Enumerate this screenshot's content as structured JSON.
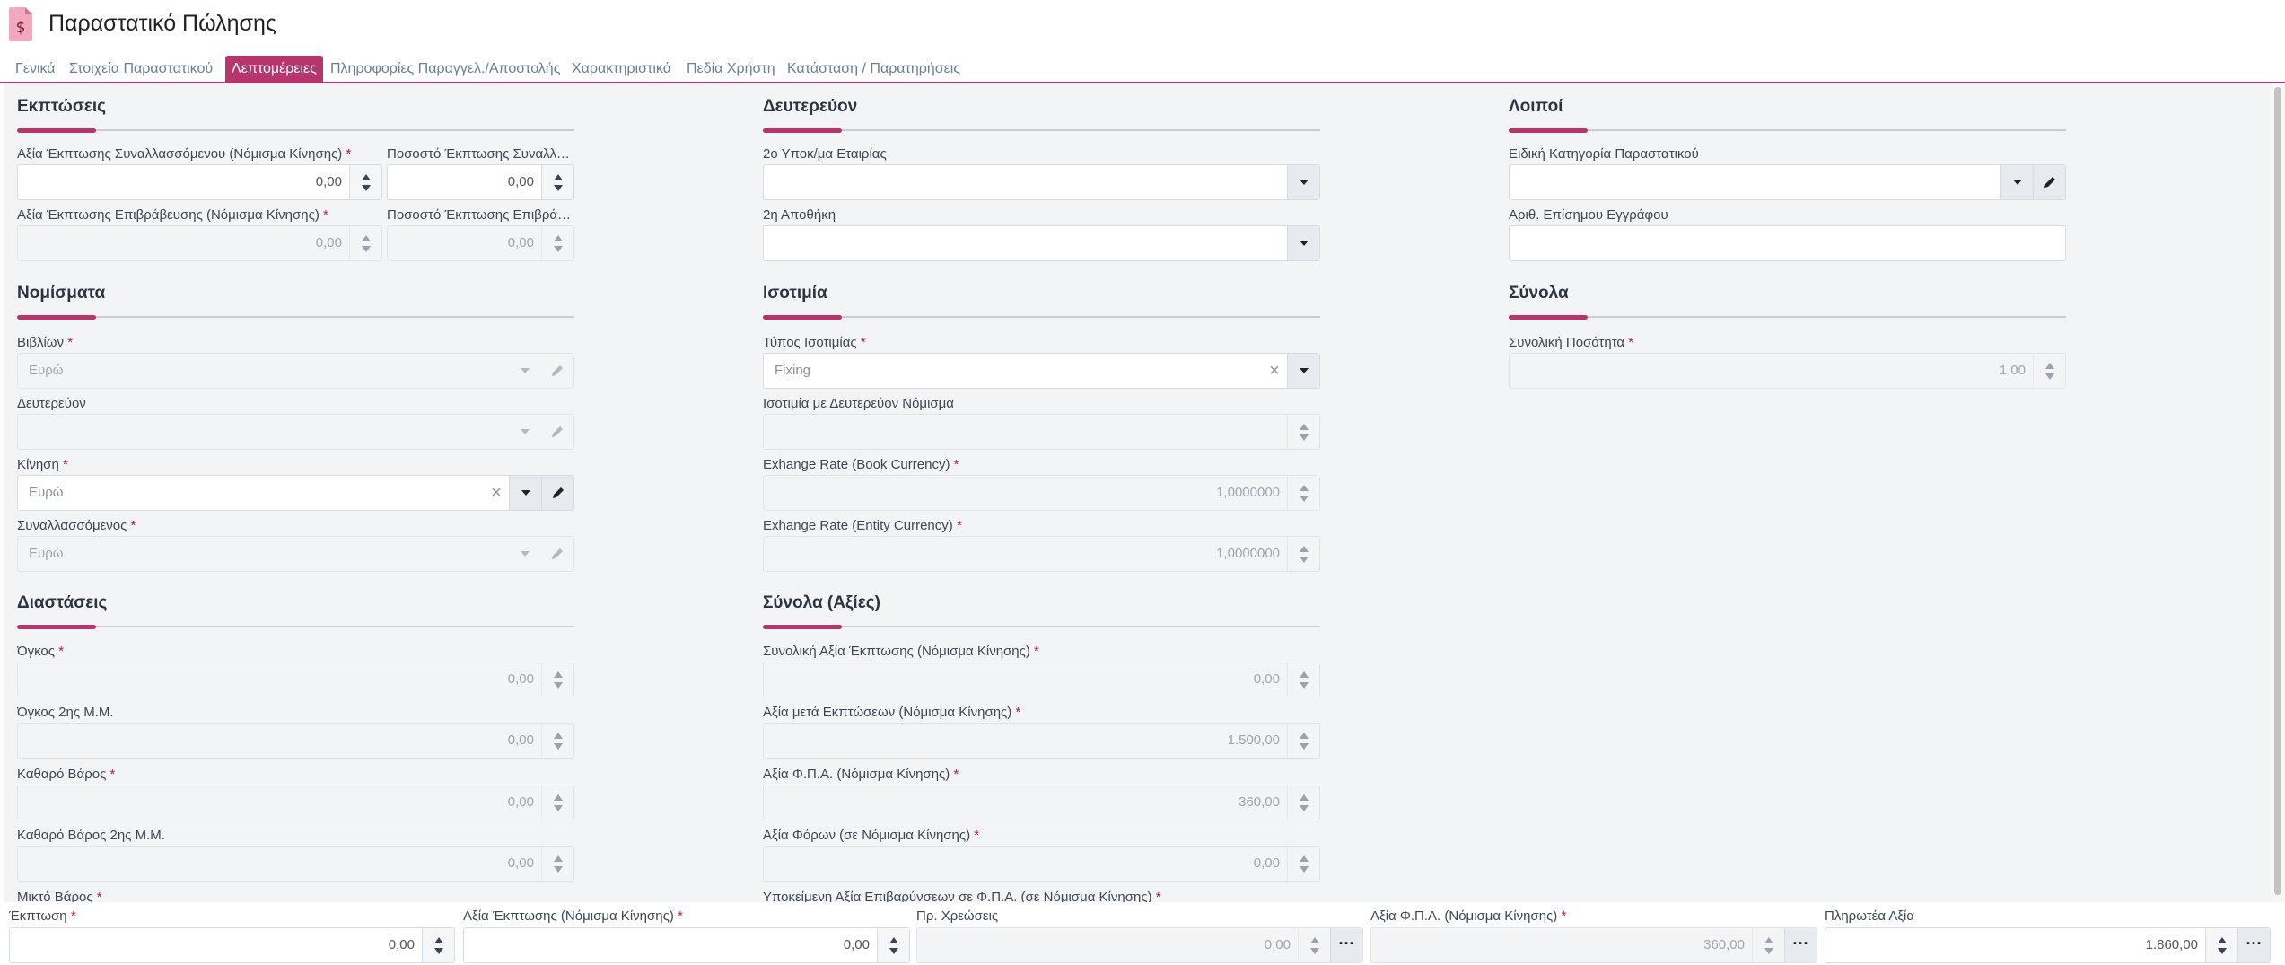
{
  "title": "Παραστατικό Πώλησης",
  "tabs": [
    "Γενικά",
    "Στοιχεία Παραστατικού",
    "Λεπτομέρειες",
    "Πληροφορίες Παραγγελ./Αποστολής",
    "Χαρακτηριστικά",
    "Πεδία Χρήστη",
    "Κατάσταση / Παρατηρήσεις"
  ],
  "active_tab": "Λεπτομέρειες",
  "accent_color": "#b7356a",
  "required_mark": "*",
  "sections": {
    "discounts": {
      "title": "Εκπτώσεις",
      "f1_label": "Αξία Έκπτωσης Συναλλασσόμενου (Νόμισμα Κίνησης)",
      "f1_value": "0,00",
      "f2_label": "Ποσοστό Έκπτωσης Συναλλασσόμενου",
      "f2_value": "0,00",
      "f3_label": "Αξία Έκπτωσης Επιβράβευσης (Νόμισμα Κίνησης)",
      "f3_value": "0,00",
      "f4_label": "Ποσοστό Έκπτωσης Επιβράβευσης",
      "f4_value": "0,00"
    },
    "secondary": {
      "title": "Δευτερεύον",
      "f1_label": "2ο Υποκ/μα Εταιρίας",
      "f1_value": "",
      "f2_label": "2η Αποθήκη",
      "f2_value": ""
    },
    "other": {
      "title": "Λοιποί",
      "f1_label": "Ειδική Κατηγορία Παραστατικού",
      "f1_value": "",
      "f2_label": "Αριθ. Επίσημου Εγγράφου",
      "f2_value": ""
    },
    "currencies": {
      "title": "Νομίσματα",
      "f1_label": "Βιβλίων",
      "f1_value": "Ευρώ",
      "f2_label": "Δευτερεύον",
      "f2_value": "",
      "f3_label": "Κίνηση",
      "f3_value": "Ευρώ",
      "f4_label": "Συναλλασσόμενος",
      "f4_value": "Ευρώ"
    },
    "parity": {
      "title": "Ισοτιμία",
      "f1_label": "Τύπος Ισοτιμίας",
      "f1_value": "Fixing",
      "f2_label": "Ισοτιμία με Δευτερεύον Νόμισμα",
      "f2_value": "",
      "f3_label": "Exhange Rate (Book Currency)",
      "f3_value": "1,0000000",
      "f4_label": "Exhange Rate (Entity Currency)",
      "f4_value": "1,0000000"
    },
    "totals": {
      "title": "Σύνολα",
      "f1_label": "Συνολική Ποσότητα",
      "f1_value": "1,00"
    },
    "dimensions": {
      "title": "Διαστάσεις",
      "f1_label": "Όγκος",
      "f1_value": "0,00",
      "f2_label": "Όγκος 2ης Μ.Μ.",
      "f2_value": "0,00",
      "f3_label": "Καθαρό Βάρος",
      "f3_value": "0,00",
      "f4_label": "Καθαρό Βάρος 2ης Μ.Μ.",
      "f4_value": "0,00",
      "f5_label": "Μικτό Βάρος"
    },
    "value_totals": {
      "title": "Σύνολα (Αξίες)",
      "f1_label": "Συνολική Αξία Έκπτωσης (Νόμισμα Κίνησης)",
      "f1_value": "0,00",
      "f2_label": "Αξία μετά Εκπτώσεων (Νόμισμα Κίνησης)",
      "f2_value": "1.500,00",
      "f3_label": "Αξία Φ.Π.Α. (Νόμισμα Κίνησης)",
      "f3_value": "360,00",
      "f4_label": "Αξία Φόρων (σε Νόμισμα Κίνησης)",
      "f4_value": "0,00",
      "f5_label": "Υποκείμενη Αξία Επιβαρύνσεων σε Φ.Π.Α. (σε Νόμισμα Κίνησης)"
    }
  },
  "footer": {
    "f1_label": "Έκπτωση",
    "f1_value": "0,00",
    "f2_label": "Αξία Έκπτωσης (Νόμισμα Κίνησης)",
    "f2_value": "0,00",
    "f3_label": "Πρ. Χρεώσεις",
    "f3_value": "0,00",
    "f4_label": "Αξία Φ.Π.Α. (Νόμισμα Κίνησης)",
    "f4_value": "360,00",
    "f5_label": "Πληρωτέα Αξία",
    "f5_value": "1.860,00"
  }
}
